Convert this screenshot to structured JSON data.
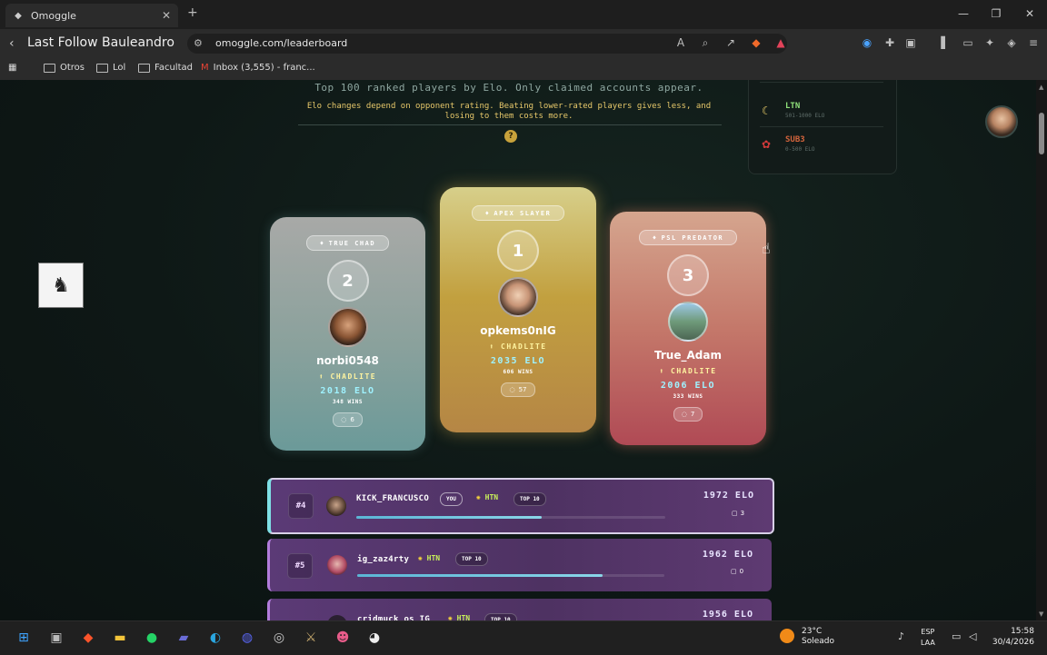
{
  "browser": {
    "tab_title": "Omoggle",
    "new_tab": "+",
    "page_title": "Last Follow Bauleandro",
    "url": "omoggle.com/leaderboard",
    "bookmarks": [
      "Otros",
      "Lol",
      "Facultad",
      "Inbox (3,555) - franc..."
    ],
    "window_controls": [
      "minimize",
      "maximize",
      "close"
    ]
  },
  "header": {
    "subtitle": "Top 100 ranked players by Elo. Only claimed accounts appear.",
    "note": "Elo changes depend on opponent rating. Beating lower-rated players gives less, and losing to them costs more.",
    "help": "?"
  },
  "tiers": [
    {
      "name": "LTN",
      "range": "501-1000 ELO",
      "color": "#8fe07a",
      "icon": "moon-icon"
    },
    {
      "name": "SUB3",
      "range": "0-500 ELO",
      "color": "#d2643c",
      "icon": "rose-icon"
    }
  ],
  "podium": [
    {
      "badge": "TRUE CHAD",
      "rank": "2",
      "name": "norbi0548",
      "tier": "CHADLITE",
      "elo": "2018 ELO",
      "wins": "348 WINS",
      "comments": "6"
    },
    {
      "badge": "APEX SLAYER",
      "rank": "1",
      "name": "opkems0nIG",
      "tier": "CHADLITE",
      "elo": "2035 ELO",
      "wins": "606 WINS",
      "comments": "57"
    },
    {
      "badge": "PSL PREDATOR",
      "rank": "3",
      "name": "True_Adam",
      "tier": "CHADLITE",
      "elo": "2006 ELO",
      "wins": "333 WINS",
      "comments": "7"
    }
  ],
  "rows": [
    {
      "rank": "#4",
      "name": "KICK_FRANCUSCO",
      "you": "YOU",
      "tier": "HTN",
      "top": "TOP 10",
      "elo": "1972 ELO",
      "comments": "3",
      "progress": 0.6
    },
    {
      "rank": "#5",
      "name": "ig_zaz4rty",
      "tier": "HTN",
      "top": "TOP 10",
      "elo": "1962 ELO",
      "comments": "0",
      "progress": 0.8
    },
    {
      "rank": "#6",
      "name": "cridmuck_os_IG",
      "tier": "HTN",
      "top": "TOP 10",
      "elo": "1956 ELO"
    }
  ],
  "taskbar": {
    "weather_temp": "23°C",
    "weather_desc": "Soleado",
    "lang1": "ESP",
    "lang2": "LAA",
    "time": "15:58",
    "date": "30/4/2026"
  }
}
